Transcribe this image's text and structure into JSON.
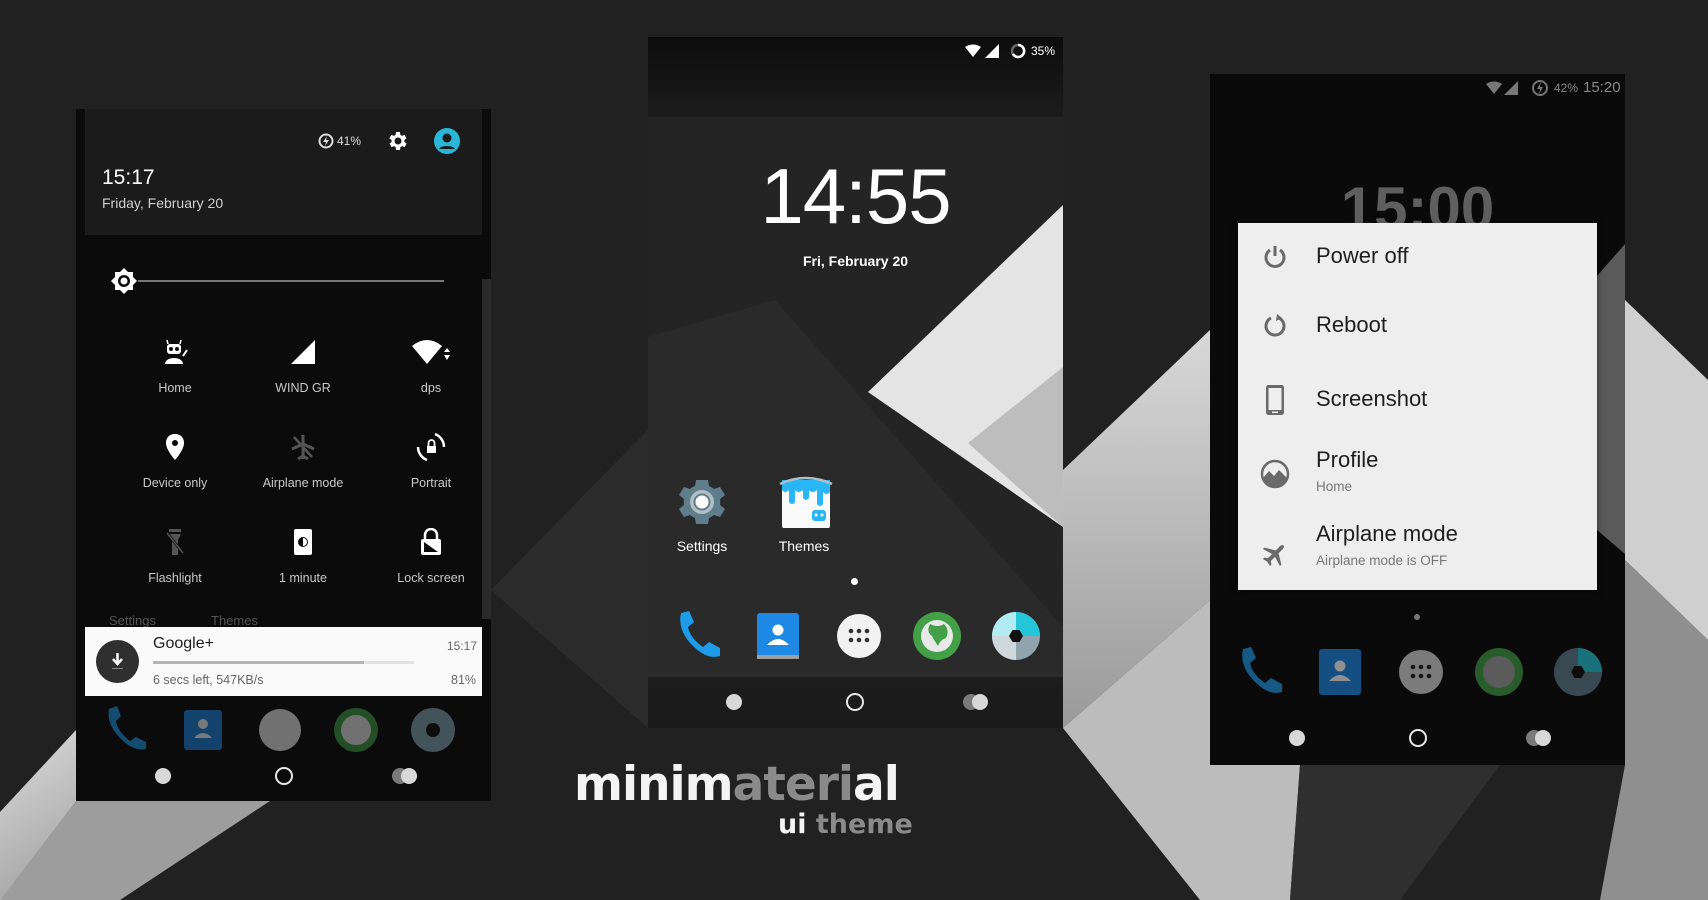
{
  "left_panel": {
    "header": {
      "battery_text": "41%",
      "time": "15:17",
      "date": "Friday, February 20"
    },
    "brightness": {
      "level": 0.0
    },
    "tiles": [
      {
        "label": "Home",
        "icon": "cyanogenmod-profile-icon"
      },
      {
        "label": "WIND GR",
        "icon": "signal-icon"
      },
      {
        "label": "dps",
        "icon": "wifi-icon"
      },
      {
        "label": "Device only",
        "icon": "location-icon"
      },
      {
        "label": "Airplane mode",
        "icon": "airplane-icon"
      },
      {
        "label": "Portrait",
        "icon": "rotation-lock-icon"
      },
      {
        "label": "Flashlight",
        "icon": "flashlight-off-icon"
      },
      {
        "label": "1 minute",
        "icon": "screen-timeout-icon"
      },
      {
        "label": "Lock screen",
        "icon": "lock-screen-icon"
      }
    ],
    "behind_labels": [
      "Settings",
      "Themes"
    ],
    "notification": {
      "title": "Google+",
      "time": "15:17",
      "detail": "6 secs left, 547KB/s",
      "percent_text": "81%",
      "progress": 0.81
    }
  },
  "center_panel": {
    "status": {
      "battery_text": "35%"
    },
    "clock": "14:55",
    "date": "Fri, February 20",
    "apps": [
      {
        "label": "Settings",
        "icon": "settings-app-icon"
      },
      {
        "label": "Themes",
        "icon": "themes-app-icon"
      }
    ],
    "dock": [
      "phone-icon",
      "contacts-icon",
      "app-drawer-icon",
      "browser-icon",
      "camera-icon"
    ]
  },
  "right_panel": {
    "status": {
      "battery_text": "42%",
      "time": "15:20"
    },
    "clock_behind": "15:00",
    "power_menu": [
      {
        "label": "Power off",
        "sub": "",
        "icon": "power-icon"
      },
      {
        "label": "Reboot",
        "sub": "",
        "icon": "reboot-icon"
      },
      {
        "label": "Screenshot",
        "sub": "",
        "icon": "screenshot-icon"
      },
      {
        "label": "Profile",
        "sub": "Home",
        "icon": "profile-icon"
      },
      {
        "label": "Airplane mode",
        "sub": "Airplane mode is OFF",
        "icon": "airplane-icon"
      }
    ]
  },
  "branding": {
    "title_part1": "minim",
    "title_part2": "ateri",
    "title_part3": "al",
    "subtitle_part1": "ui",
    "subtitle_part2": " theme"
  },
  "colors": {
    "accent_cyan": "#29b6d8",
    "phone_blue": "#1e9be9",
    "browser_green": "#43a047"
  }
}
